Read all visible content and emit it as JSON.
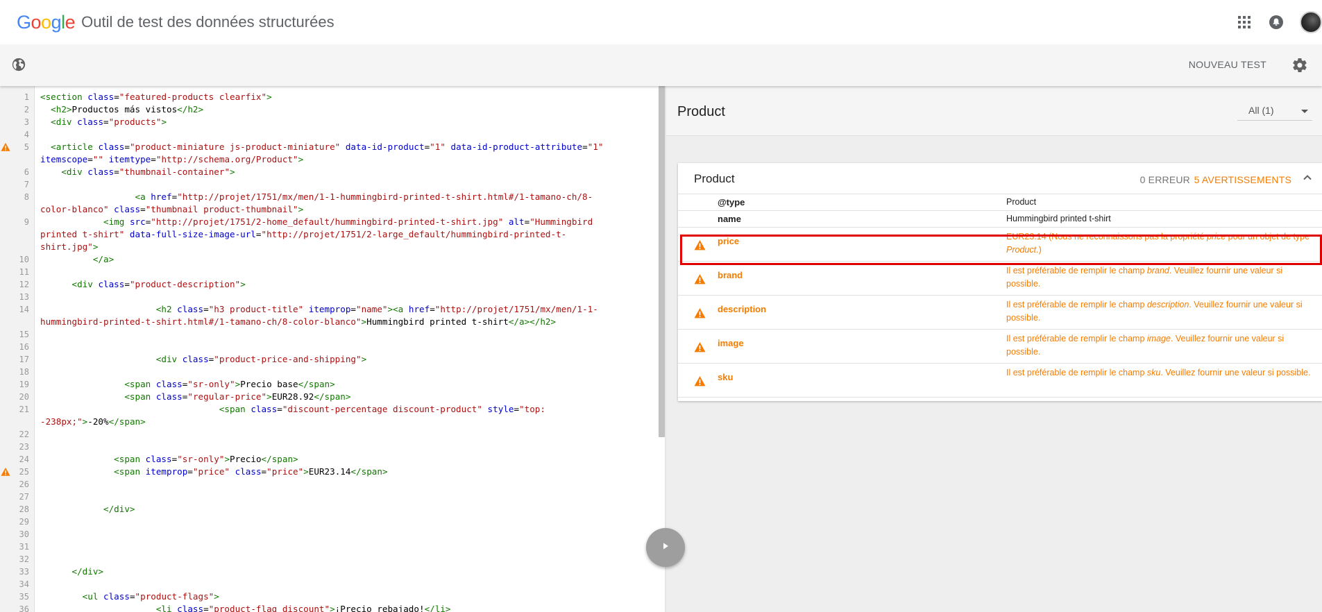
{
  "app": {
    "logo_letters": [
      {
        "ch": "G",
        "color": "#4285F4"
      },
      {
        "ch": "o",
        "color": "#EA4335"
      },
      {
        "ch": "o",
        "color": "#FBBC05"
      },
      {
        "ch": "g",
        "color": "#4285F4"
      },
      {
        "ch": "l",
        "color": "#34A853"
      },
      {
        "ch": "e",
        "color": "#EA4335"
      }
    ],
    "title": "Outil de test des données structurées",
    "icons": [
      "apps-grid-icon",
      "notifications-icon",
      "avatar"
    ]
  },
  "toolbar": {
    "globe_icon": "globe-icon",
    "new_test_label": "NOUVEAU TEST",
    "settings_icon": "gear-icon"
  },
  "editor": {
    "lines": [
      {
        "n": "1",
        "html": "<span class=\"c-tag\">&lt;section</span> <span class=\"c-attr\">class</span>=<span class=\"c-str\">\"featured-products clearfix\"</span><span class=\"c-tag\">&gt;</span>"
      },
      {
        "n": "2",
        "html": "  <span class=\"c-tag\">&lt;h2&gt;</span>Productos más vistos<span class=\"c-tag\">&lt;/h2&gt;</span>"
      },
      {
        "n": "3",
        "html": "  <span class=\"c-tag\">&lt;div</span> <span class=\"c-attr\">class</span>=<span class=\"c-str\">\"products\"</span><span class=\"c-tag\">&gt;</span>"
      },
      {
        "n": "4",
        "html": ""
      },
      {
        "n": "5",
        "warn": true,
        "html": "  <span class=\"c-tag\">&lt;article</span> <span class=\"c-attr\">class</span>=<span class=\"c-str\">\"product-miniature js-product-miniature\"</span> <span class=\"c-attr\">data-id-product</span>=<span class=\"c-str\">\"1\"</span> <span class=\"c-attr\">data-id-product-attribute</span>=<span class=\"c-str\">\"1\"</span>\n<span class=\"c-attr\">itemscope</span>=<span class=\"c-str\">\"\"</span> <span class=\"c-attr\">itemtype</span>=<span class=\"c-str\">\"http://schema.org/Product\"</span><span class=\"c-tag\">&gt;</span>"
      },
      {
        "n": "6",
        "html": "    <span class=\"c-tag\">&lt;div</span> <span class=\"c-attr\">class</span>=<span class=\"c-str\">\"thumbnail-container\"</span><span class=\"c-tag\">&gt;</span>"
      },
      {
        "n": "7",
        "html": ""
      },
      {
        "n": "8",
        "html": "                  <span class=\"c-tag\">&lt;a</span> <span class=\"c-attr\">href</span>=<span class=\"c-str\">\"http://projet/1751/mx/men/1-1-hummingbird-printed-t-shirt.html#/1-tamano-ch/8-\ncolor-blanco\"</span> <span class=\"c-attr\">class</span>=<span class=\"c-str\">\"thumbnail product-thumbnail\"</span><span class=\"c-tag\">&gt;</span>"
      },
      {
        "n": "9",
        "html": "            <span class=\"c-tag\">&lt;img</span> <span class=\"c-attr\">src</span>=<span class=\"c-str\">\"http://projet/1751/2-home_default/hummingbird-printed-t-shirt.jpg\"</span> <span class=\"c-attr\">alt</span>=<span class=\"c-str\">\"Hummingbird\nprinted t-shirt\"</span> <span class=\"c-attr\">data-full-size-image-url</span>=<span class=\"c-str\">\"http://projet/1751/2-large_default/hummingbird-printed-t-\nshirt.jpg\"</span><span class=\"c-tag\">&gt;</span>"
      },
      {
        "n": "10",
        "html": "          <span class=\"c-tag\">&lt;/a&gt;</span>"
      },
      {
        "n": "11",
        "html": ""
      },
      {
        "n": "12",
        "html": "      <span class=\"c-tag\">&lt;div</span> <span class=\"c-attr\">class</span>=<span class=\"c-str\">\"product-description\"</span><span class=\"c-tag\">&gt;</span>"
      },
      {
        "n": "13",
        "html": ""
      },
      {
        "n": "14",
        "html": "                      <span class=\"c-tag\">&lt;h2</span> <span class=\"c-attr\">class</span>=<span class=\"c-str\">\"h3 product-title\"</span> <span class=\"c-attr\">itemprop</span>=<span class=\"c-str\">\"name\"</span><span class=\"c-tag\">&gt;&lt;a</span> <span class=\"c-attr\">href</span>=<span class=\"c-str\">\"http://projet/1751/mx/men/1-1-\nhummingbird-printed-t-shirt.html#/1-tamano-ch/8-color-blanco\"</span><span class=\"c-tag\">&gt;</span>Hummingbird printed t-shirt<span class=\"c-tag\">&lt;/a&gt;&lt;/h2&gt;</span>"
      },
      {
        "n": "15",
        "html": ""
      },
      {
        "n": "16",
        "html": ""
      },
      {
        "n": "17",
        "html": "                      <span class=\"c-tag\">&lt;div</span> <span class=\"c-attr\">class</span>=<span class=\"c-str\">\"product-price-and-shipping\"</span><span class=\"c-tag\">&gt;</span>"
      },
      {
        "n": "18",
        "html": ""
      },
      {
        "n": "19",
        "html": "                <span class=\"c-tag\">&lt;span</span> <span class=\"c-attr\">class</span>=<span class=\"c-str\">\"sr-only\"</span><span class=\"c-tag\">&gt;</span>Precio base<span class=\"c-tag\">&lt;/span&gt;</span>"
      },
      {
        "n": "20",
        "html": "                <span class=\"c-tag\">&lt;span</span> <span class=\"c-attr\">class</span>=<span class=\"c-str\">\"regular-price\"</span><span class=\"c-tag\">&gt;</span>EUR28.92<span class=\"c-tag\">&lt;/span&gt;</span>"
      },
      {
        "n": "21",
        "html": "                                  <span class=\"c-tag\">&lt;span</span> <span class=\"c-attr\">class</span>=<span class=\"c-str\">\"discount-percentage discount-product\"</span> <span class=\"c-attr\">style</span>=<span class=\"c-str\">\"top:\n-238px;\"</span><span class=\"c-tag\">&gt;</span>-20%<span class=\"c-tag\">&lt;/span&gt;</span>"
      },
      {
        "n": "22",
        "html": ""
      },
      {
        "n": "23",
        "html": ""
      },
      {
        "n": "24",
        "html": "              <span class=\"c-tag\">&lt;span</span> <span class=\"c-attr\">class</span>=<span class=\"c-str\">\"sr-only\"</span><span class=\"c-tag\">&gt;</span>Precio<span class=\"c-tag\">&lt;/span&gt;</span>"
      },
      {
        "n": "25",
        "warn": true,
        "html": "              <span class=\"c-tag\">&lt;span</span> <span class=\"c-attr\">itemprop</span>=<span class=\"c-str\">\"price\"</span> <span class=\"c-attr\">class</span>=<span class=\"c-str\">\"price\"</span><span class=\"c-tag\">&gt;</span>EUR23.14<span class=\"c-tag\">&lt;/span&gt;</span>"
      },
      {
        "n": "26",
        "html": ""
      },
      {
        "n": "27",
        "html": ""
      },
      {
        "n": "28",
        "html": "            <span class=\"c-tag\">&lt;/div&gt;</span>"
      },
      {
        "n": "29",
        "html": ""
      },
      {
        "n": "30",
        "html": ""
      },
      {
        "n": "31",
        "html": ""
      },
      {
        "n": "32",
        "html": ""
      },
      {
        "n": "33",
        "html": "      <span class=\"c-tag\">&lt;/div&gt;</span>"
      },
      {
        "n": "34",
        "html": ""
      },
      {
        "n": "35",
        "html": "        <span class=\"c-tag\">&lt;ul</span> <span class=\"c-attr\">class</span>=<span class=\"c-str\">\"product-flags\"</span><span class=\"c-tag\">&gt;</span>"
      },
      {
        "n": "36",
        "html": "                      <span class=\"c-tag\">&lt;li</span> <span class=\"c-attr\">class</span>=<span class=\"c-str\">\"product-flag discount\"</span><span class=\"c-tag\">&gt;</span>¡Precio rebajado!<span class=\"c-tag\">&lt;/li&gt;</span>"
      }
    ],
    "run_button_icon": "play-icon"
  },
  "results": {
    "header_title": "Product",
    "filter_label": "All (1)",
    "card": {
      "title": "Product",
      "error_count": "0 ERREUR",
      "warning_count": "5 AVERTISSEMENTS",
      "rows": [
        {
          "key": "@type",
          "value_html": "Product",
          "warn": false
        },
        {
          "key": "name",
          "value_html": "Hummingbird printed t-shirt",
          "warn": false
        },
        {
          "key": "price",
          "value_html": "EUR23.14 (Nous ne reconnaissons pas la propriété <i>price</i> pour un objet de type <i>Product</i>.)",
          "warn": true
        },
        {
          "key": "brand",
          "value_html": "Il est préférable de remplir le champ <i>brand</i>. Veuillez fournir une valeur si possible.",
          "warn": true
        },
        {
          "key": "description",
          "value_html": "Il est préférable de remplir le champ <i>description</i>. Veuillez fournir une valeur si possible.",
          "warn": true
        },
        {
          "key": "image",
          "value_html": "Il est préférable de remplir le champ <i>image</i>. Veuillez fournir une valeur si possible.",
          "warn": true
        },
        {
          "key": "sku",
          "value_html": "Il est préférable de remplir le champ <i>sku</i>. Veuillez fournir une valeur si possible.",
          "warn": true
        }
      ]
    }
  },
  "colors": {
    "warning": "#F57C00",
    "highlight": "#E00000",
    "code_tag": "#117700",
    "code_attr": "#0000CC",
    "code_string": "#AA1111"
  }
}
